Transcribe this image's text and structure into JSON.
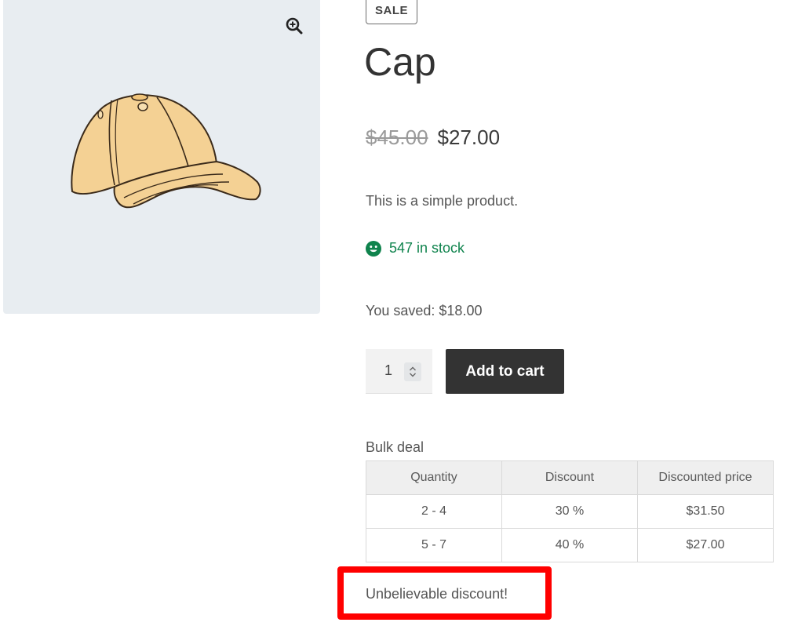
{
  "gallery": {
    "zoom_icon": "magnifier-plus-icon",
    "image_subject": "cap-icon"
  },
  "product": {
    "badge": "SALE",
    "title": "Cap",
    "price_old": "$45.00",
    "price_new": "$27.00",
    "short_description": "This is a simple product.",
    "stock_icon": "smiley-icon",
    "stock_text": "547 in stock",
    "saved_text": "You saved: $18.00"
  },
  "cart": {
    "quantity": "1",
    "add_to_cart_label": "Add to cart"
  },
  "bulk": {
    "title": "Bulk deal",
    "headers": [
      "Quantity",
      "Discount",
      "Discounted price"
    ],
    "rows": [
      [
        "2 - 4",
        "30 %",
        "$31.50"
      ],
      [
        "5 - 7",
        "40 %",
        "$27.00"
      ]
    ]
  },
  "note": {
    "text": "Unbelievable discount!"
  },
  "colors": {
    "stock_green": "#0f834d",
    "button_dark": "#333333",
    "highlight_red": "#ff0000",
    "gallery_bg": "#e8edf1"
  }
}
